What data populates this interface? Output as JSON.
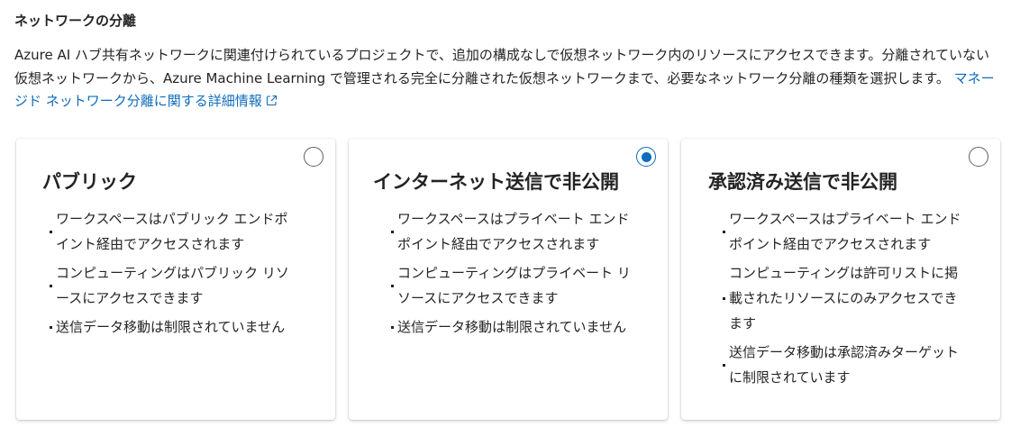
{
  "section": {
    "title": "ネットワークの分離",
    "description": "Azure AI ハブ共有ネットワークに関連付けられているプロジェクトで、追加の構成なしで仮想ネットワーク内のリソースにアクセスできます。分離されていない仮想ネットワークから、Azure Machine Learning で管理される完全に分離された仮想ネットワークまで、必要なネットワーク分離の種類を選択します。",
    "learn_more_link": "マネージド ネットワーク分離に関する詳細情報",
    "learn_more_icon": "external-link-icon",
    "accent_color": "#0f6cbd"
  },
  "options": [
    {
      "title": "パブリック",
      "selected": false,
      "bullets": [
        "ワークスペースはパブリック エンドポイント経由でアクセスされます",
        "コンピューティングはパブリック リソースにアクセスできます",
        "送信データ移動は制限されていません"
      ]
    },
    {
      "title": "インターネット送信で非公開",
      "selected": true,
      "bullets": [
        "ワークスペースはプライベート エンドポイント経由でアクセスされます",
        "コンピューティングはプライベート リソースにアクセスできます",
        "送信データ移動は制限されていません"
      ]
    },
    {
      "title": "承認済み送信で非公開",
      "selected": false,
      "bullets": [
        "ワークスペースはプライベート エンドポイント経由でアクセスされます",
        "コンピューティングは許可リストに掲載されたリソースにのみアクセスできます",
        "送信データ移動は承認済みターゲットに制限されています"
      ]
    }
  ]
}
